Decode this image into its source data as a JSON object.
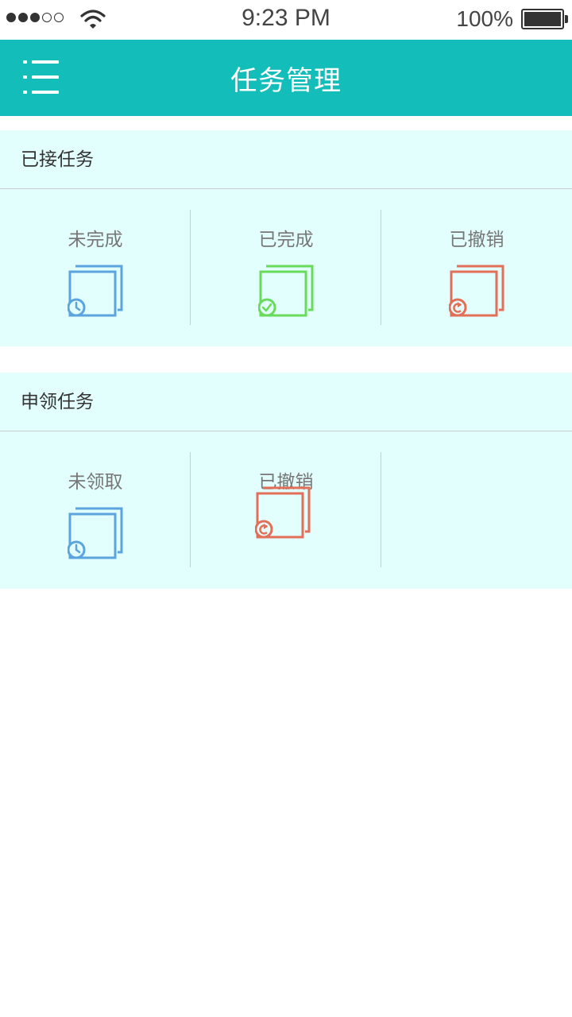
{
  "status_bar": {
    "time": "9:23 PM",
    "battery": "100%",
    "signal_icon": "signal-dots-icon",
    "wifi_icon": "wifi-icon",
    "battery_icon": "battery-icon"
  },
  "header": {
    "title": "任务管理",
    "menu_icon": "menu-list-icon",
    "background": "#13bdb9"
  },
  "sections": [
    {
      "title": "已接任务",
      "items": [
        {
          "label": "未完成",
          "icon": "pending-tasks-clock-icon",
          "color": "#5ba4de"
        },
        {
          "label": "已完成",
          "icon": "completed-tasks-check-icon",
          "color": "#69db5a"
        },
        {
          "label": "已撤销",
          "icon": "revoked-tasks-undo-icon",
          "color": "#e36f58"
        }
      ]
    },
    {
      "title": "申领任务",
      "items": [
        {
          "label": "未领取",
          "icon": "unclaimed-tasks-clock-icon",
          "color": "#5ba4de"
        },
        {
          "label": "已撤销",
          "icon": "revoked-tasks-undo-icon",
          "color": "#e36f58"
        }
      ]
    }
  ],
  "colors": {
    "section_background": "#e2fefd",
    "divider": "#c9cdcd"
  }
}
